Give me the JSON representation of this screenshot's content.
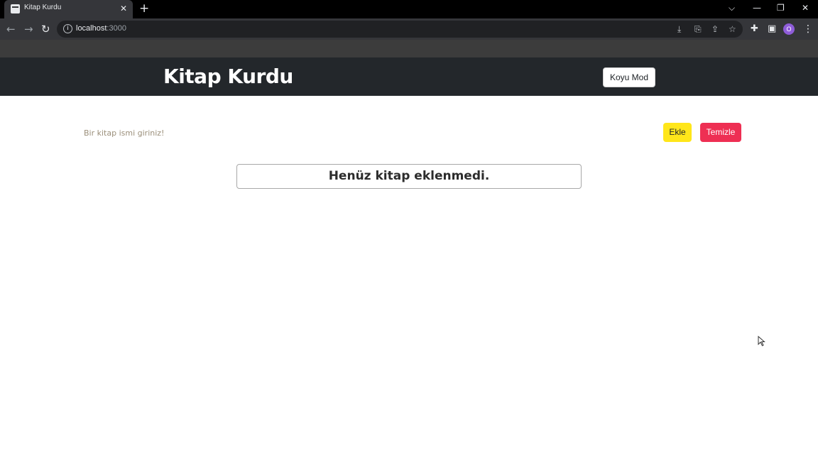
{
  "browser": {
    "tab_title": "Kitap Kurdu",
    "tab_close": "✕",
    "new_tab": "+",
    "url_host": "localhost",
    "url_port": ":3000",
    "profile_initial": "O",
    "controls": {
      "dropdown": "⌵",
      "minimize": "—",
      "restore": "❐",
      "close": "✕"
    },
    "nav": {
      "back": "←",
      "forward": "→",
      "reload": "↻"
    }
  },
  "app": {
    "title": "Kitap Kurdu",
    "mode_button": "Koyu Mod",
    "input_placeholder": "Bir kitap ismi giriniz!",
    "input_value": "",
    "add_button": "Ekle",
    "clear_button": "Temizle",
    "empty_message": "Henüz kitap eklenmedi."
  },
  "colors": {
    "header_bg": "#23272b",
    "add_button": "#ffe61a",
    "clear_button": "#ee2f53"
  }
}
